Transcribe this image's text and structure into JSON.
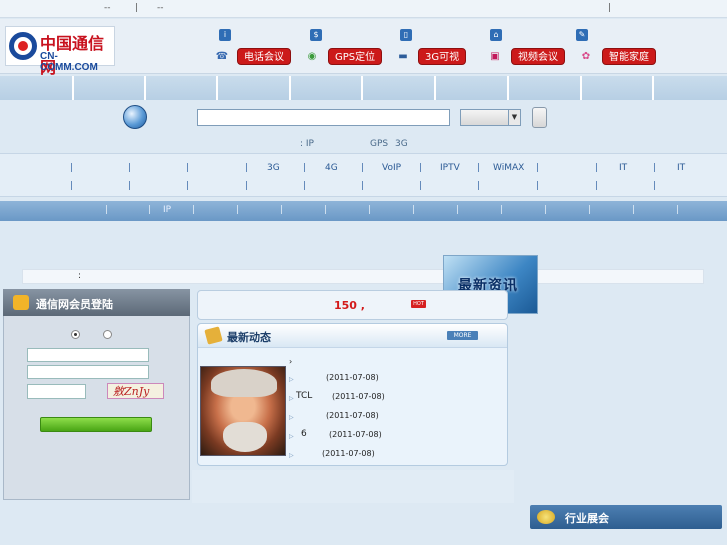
{
  "topbar": {
    "items": [
      "--",
      "|",
      "--",
      "|"
    ]
  },
  "logo": {
    "cn": "中国通信网",
    "en": "CN-COMM.COM"
  },
  "features": [
    {
      "label": "电话会议",
      "icon": "phone-icon"
    },
    {
      "label": "GPS定位",
      "icon": "gps-icon"
    },
    {
      "label": "3G可视",
      "icon": "car-icon"
    },
    {
      "label": "视频会议",
      "icon": "video-icon"
    },
    {
      "label": "智能家庭",
      "icon": "home-icon"
    }
  ],
  "search": {
    "placeholder": ""
  },
  "hot_tags": {
    "a": ": IP",
    "b": "GPS",
    "c": "3G"
  },
  "categories": {
    "row1": [
      "3G",
      "4G",
      "VoIP",
      "IPTV",
      "WiMAX",
      "IT",
      "IT"
    ]
  },
  "bluebar": {
    "ip": "IP"
  },
  "newsstrip": {
    "colon": ":"
  },
  "newsimg": {
    "text": "最新资讯"
  },
  "login": {
    "title": "通信网会员登陆",
    "captcha": "敫ZnJy"
  },
  "notice": {
    "number": "150 ,",
    "hot": "HOT"
  },
  "latest": {
    "title": "最新动态",
    "more": "MORE",
    "items": [
      {
        "prefix": "",
        "date": ""
      },
      {
        "prefix": "",
        "date": "(2011-07-08)"
      },
      {
        "prefix": "TCL",
        "date": "(2011-07-08)"
      },
      {
        "prefix": "",
        "date": "(2011-07-08)"
      },
      {
        "prefix": "6",
        "date": "(2011-07-08)"
      },
      {
        "prefix": "",
        "date": "(2011-07-08)"
      }
    ]
  },
  "expo": {
    "title": "行业展会"
  }
}
